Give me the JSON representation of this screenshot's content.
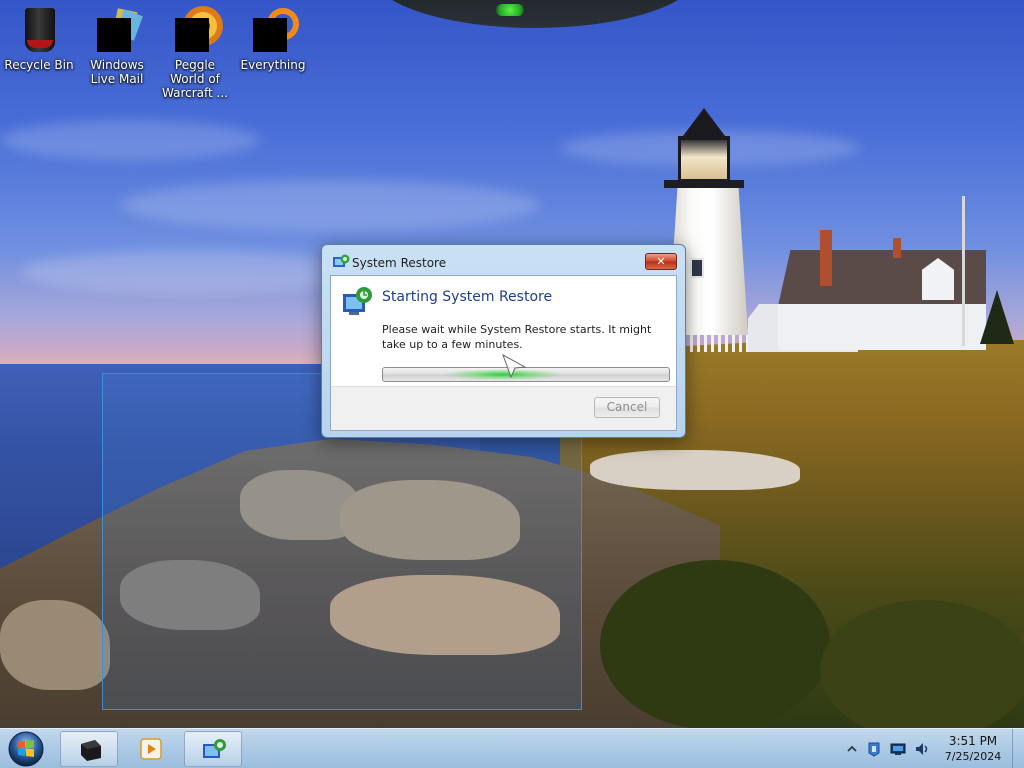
{
  "desktop": {
    "icons": [
      {
        "label": "Recycle Bin",
        "icon": "recycle-bin-icon"
      },
      {
        "label": "Windows Live Mail",
        "icon": "windows-live-mail-icon"
      },
      {
        "label": "Peggle World of Warcraft ...",
        "icon": "peggle-icon"
      },
      {
        "label": "Everything",
        "icon": "everything-search-icon"
      }
    ]
  },
  "dialog": {
    "title": "System Restore",
    "close_label": "✕",
    "heading": "Starting System Restore",
    "message": "Please wait while System Restore starts. It might take up to a few minutes.",
    "progress": "indeterminate",
    "cancel_label": "Cancel",
    "cancel_enabled": false
  },
  "taskbar": {
    "buttons": [
      {
        "icon": "start-orb-icon"
      },
      {
        "icon": "explorer-icon"
      },
      {
        "icon": "media-player-icon"
      },
      {
        "icon": "system-restore-icon",
        "active": true
      }
    ],
    "tray": {
      "icons": [
        "show-hidden-icons-chevron",
        "action-center-icon",
        "network-icon",
        "volume-icon"
      ],
      "time": "3:51 PM",
      "date": "7/25/2024"
    }
  },
  "colors": {
    "dialog_heading": "#1e3f8a",
    "progress_glow": "#28c83c",
    "close_button": "#d0482c"
  }
}
